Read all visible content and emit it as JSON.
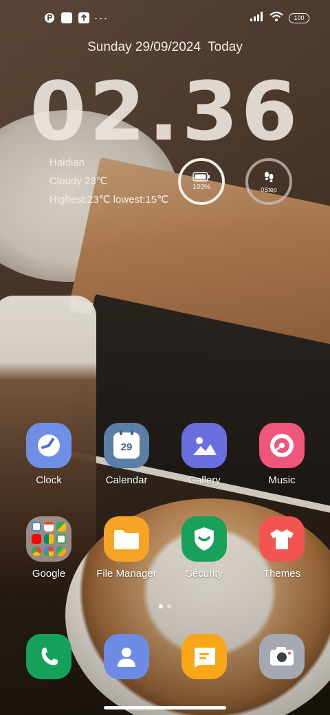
{
  "status_bar": {
    "battery_level": "100",
    "icons_left": [
      "notification-icon",
      "square-notification-icon",
      "upload-notification-icon",
      "more-dots-icon"
    ],
    "icons_right": [
      "signal-icon",
      "wifi-icon",
      "battery-icon"
    ]
  },
  "lockscreen": {
    "date": "Sunday 29/09/2024",
    "date_suffix": "Today",
    "time": "02.36"
  },
  "weather": {
    "location": "Haidian",
    "condition": "Cloudy 23℃",
    "range": "Highest:23℃ lowest:15℃"
  },
  "widgets": {
    "battery": {
      "label": "100%",
      "level": 1.0
    },
    "steps": {
      "label": "0Step"
    }
  },
  "apps_row1": [
    {
      "label": "Clock",
      "color": "#6f8fe6"
    },
    {
      "label": "Calendar",
      "color": "#5a7ea6",
      "day": "29"
    },
    {
      "label": "Gallery",
      "color": "#6a6fe0"
    },
    {
      "label": "Music",
      "color": "#f0567b"
    }
  ],
  "apps_row2": [
    {
      "label": "Google",
      "color": "rgba(230,225,220,0.55)"
    },
    {
      "label": "File Manager",
      "color": "#f7a325"
    },
    {
      "label": "Security",
      "color": "#19a05a"
    },
    {
      "label": "Themes",
      "color": "#f2544f"
    }
  ],
  "dock": [
    {
      "name": "phone",
      "color": "#15a15a"
    },
    {
      "name": "contacts",
      "color": "#6b8be4"
    },
    {
      "name": "messages",
      "color": "#f9a718"
    },
    {
      "name": "camera",
      "color": "#a4a8b2"
    }
  ],
  "page_indicator": {
    "pages": 2,
    "current": 1
  }
}
